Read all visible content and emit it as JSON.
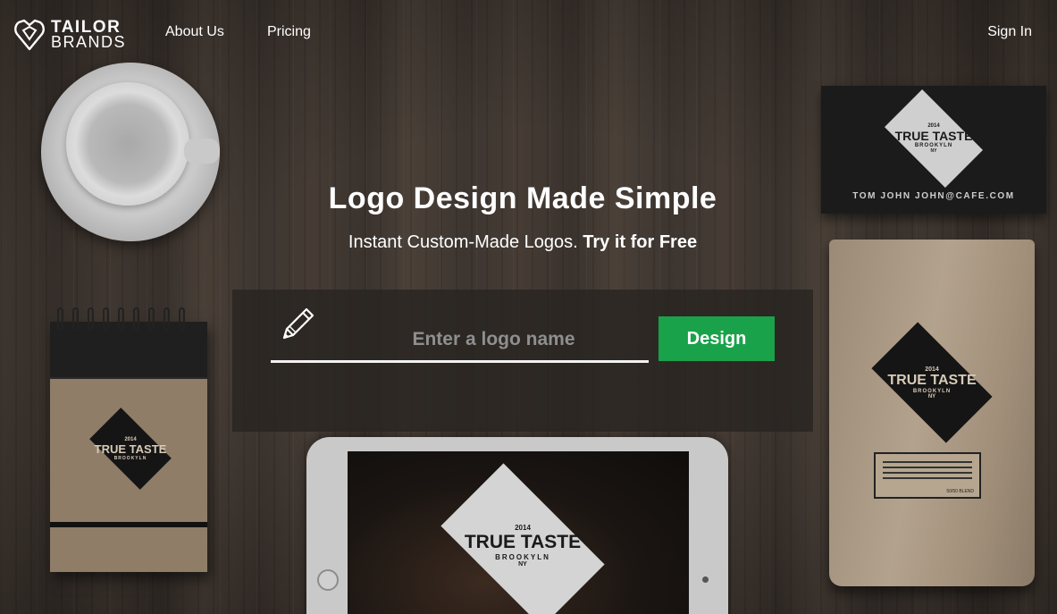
{
  "brand": {
    "line1": "TAILOR",
    "line2": "BRANDS"
  },
  "nav": {
    "about": "About Us",
    "pricing": "Pricing",
    "signin": "Sign In"
  },
  "hero": {
    "title": "Logo Design Made Simple",
    "subtitle": "Instant Custom-Made Logos.",
    "subtitle_strong": "Try it for Free"
  },
  "form": {
    "placeholder": "Enter a logo name",
    "value": "",
    "button": "Design"
  },
  "mockups": {
    "brand_name": "TRUE TASTE",
    "year": "2014",
    "city": "BROOKYLN",
    "state": "NY",
    "card_contact": "TOM JOHN JOHN@CAFE.COM",
    "bag_label_code": "50/50 BLEND"
  },
  "colors": {
    "accent_green": "#1aa24b",
    "text_white": "#ffffff"
  },
  "icons": {
    "logo": "heart-tag-icon",
    "pencil": "pencil-icon"
  }
}
